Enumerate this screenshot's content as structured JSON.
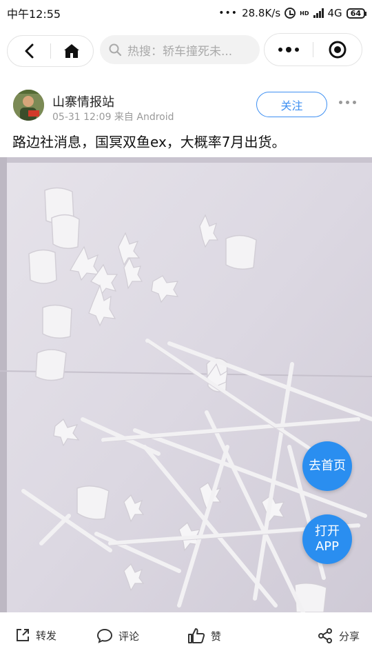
{
  "status_bar": {
    "time": "中午12:55",
    "network_speed": "28.8K/s",
    "network_type": "4G",
    "hd_label": "HD",
    "battery": "64"
  },
  "nav": {
    "search_placeholder": "热搜：轿车撞死未..."
  },
  "post": {
    "author": "山寨情报站",
    "meta": "05-31 12:09 来自 Android",
    "follow_label": "关注",
    "text": "路边社消息，国冥双鱼ex，大概率7月出货。"
  },
  "floating": {
    "home_label": "去首页",
    "open_app_line1": "打开",
    "open_app_line2": "APP"
  },
  "bottom_bar": {
    "repost_label": "转发",
    "comment_label": "评论",
    "like_label": "赞",
    "share_label": "分享"
  },
  "colors": {
    "accent": "#3d8ff2",
    "floating_button": "#2a8ef0",
    "photo_background": "#dcd8e2"
  },
  "icons": [
    "back-arrow-icon",
    "home-icon",
    "search-icon",
    "more-icon",
    "target-icon",
    "repost-icon",
    "comment-icon",
    "like-icon",
    "share-icon"
  ]
}
